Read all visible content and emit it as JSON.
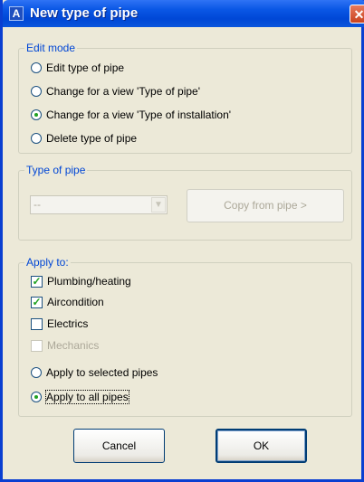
{
  "window": {
    "title": "New type of pipe",
    "app_icon": "autocad-icon",
    "close_icon": "close-icon"
  },
  "edit_mode": {
    "legend": "Edit mode",
    "options": [
      {
        "label": "Edit type of pipe",
        "checked": false
      },
      {
        "label": "Change for a view 'Type of pipe'",
        "checked": false
      },
      {
        "label": "Change for a view 'Type of installation'",
        "checked": true
      },
      {
        "label": "Delete type of pipe",
        "checked": false
      }
    ]
  },
  "type_of_pipe": {
    "legend": "Type of pipe",
    "combo_value": "--",
    "copy_button": "Copy from pipe >"
  },
  "apply_to": {
    "legend": "Apply to:",
    "checks": [
      {
        "label": "Plumbing/heating",
        "checked": true,
        "enabled": true
      },
      {
        "label": "Aircondition",
        "checked": true,
        "enabled": true
      },
      {
        "label": "Electrics",
        "checked": false,
        "enabled": true
      },
      {
        "label": "Mechanics",
        "checked": false,
        "enabled": false
      }
    ],
    "radios": [
      {
        "label": "Apply to selected pipes",
        "checked": false
      },
      {
        "label": "Apply to all pipes",
        "checked": true
      }
    ]
  },
  "buttons": {
    "cancel": "Cancel",
    "ok": "OK"
  }
}
